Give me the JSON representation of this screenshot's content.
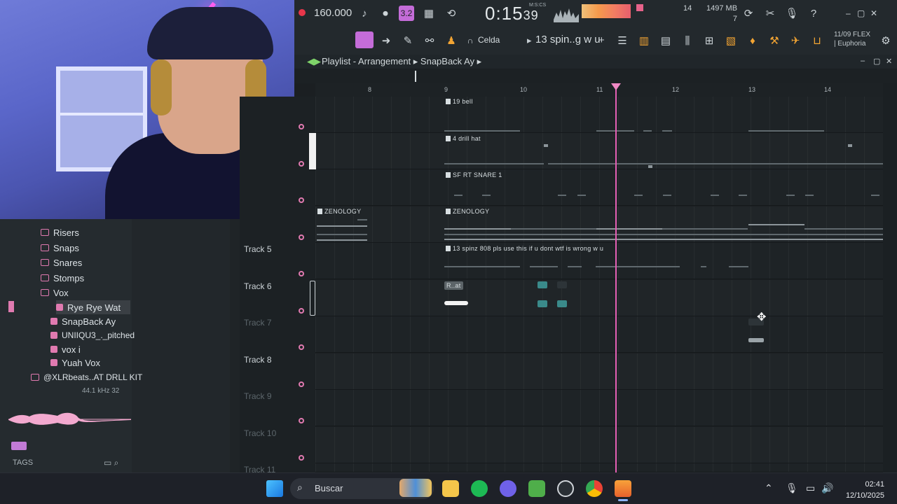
{
  "toolbar": {
    "tempo": "160.000",
    "time": "0:15",
    "time_sub": "39",
    "msc": "M:S:CS",
    "snap_label": "3.2",
    "cpu_count": "14",
    "memory": "1497 MB",
    "voices": "7",
    "snap_mode": "Celda",
    "pattern": "13 spin..g w u",
    "flex_date": "11/09  FLEX",
    "flex_name": "| Euphoria"
  },
  "playlist": {
    "title": "Playlist - Arrangement",
    "arrangement": "SnapBack Ay",
    "bars": [
      "8",
      "9",
      "10",
      "11",
      "12",
      "13",
      "14"
    ]
  },
  "tracks": [
    {
      "name": "",
      "clip": "19 bell"
    },
    {
      "name": "",
      "clip": "4 drill hat"
    },
    {
      "name": "",
      "clip": "SF RT SNARE 1"
    },
    {
      "name": "",
      "clip": "ZENOLOGY",
      "clip2": "ZENOLOGY"
    },
    {
      "name": "Track 5",
      "clip": "13 spinz 808 pls use this if u dont wtf is wrong w u"
    },
    {
      "name": "Track 6",
      "clip": "R..at"
    },
    {
      "name": "Track 7"
    },
    {
      "name": "Track 8"
    },
    {
      "name": "Track 9"
    },
    {
      "name": "Track 10"
    },
    {
      "name": "Track 11"
    }
  ],
  "browser": {
    "items": [
      {
        "label": "Risers",
        "type": "folder"
      },
      {
        "label": "Snaps",
        "type": "folder"
      },
      {
        "label": "Snares",
        "type": "folder"
      },
      {
        "label": "Stomps",
        "type": "folder"
      },
      {
        "label": "Vox",
        "type": "folder"
      },
      {
        "label": "Rye Rye Wat",
        "type": "pattern",
        "selected": true
      },
      {
        "label": "SnapBack Ay",
        "type": "pattern"
      },
      {
        "label": "UNIIQU3_._pitched",
        "type": "pattern"
      },
      {
        "label": "vox i",
        "type": "pattern"
      },
      {
        "label": "Yuah Vox",
        "type": "pattern"
      },
      {
        "label": "@XLRbeats..AT DRLL KIT",
        "type": "folder"
      }
    ],
    "sample_info": "44.1 kHz 32",
    "tags_label": "TAGS"
  },
  "taskbar": {
    "search_placeholder": "Buscar",
    "time": "02:41",
    "date": "12/10/2025"
  },
  "colors": {
    "accent": "#c46cd8",
    "playhead": "#e45fb4",
    "browser_icon": "#e07ab0"
  }
}
